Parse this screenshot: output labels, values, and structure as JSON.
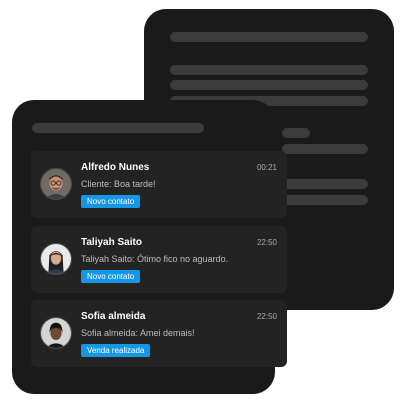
{
  "theme": {
    "card_bg": "#1a1a1a",
    "row_bg": "#232323",
    "placeholder": "#3b3b3b",
    "tag_bg": "#1597e5"
  },
  "chats": [
    {
      "name": "Alfredo Nunes",
      "time": "00:21",
      "message": "Cliente: Boa tarde!",
      "tag": "Novo contato",
      "avatar_icon": "avatar-man-glasses"
    },
    {
      "name": "Taliyah Saito",
      "time": "22:50",
      "message": "Taliyah Saito: Ótimo fico no aguardo.",
      "tag": "Novo contato",
      "avatar_icon": "avatar-woman"
    },
    {
      "name": "Sofia almeida",
      "time": "22:50",
      "message": "Sofia almeida: Amei demais!",
      "tag": "Venda realizada",
      "avatar_icon": "avatar-woman-short-hair"
    }
  ]
}
